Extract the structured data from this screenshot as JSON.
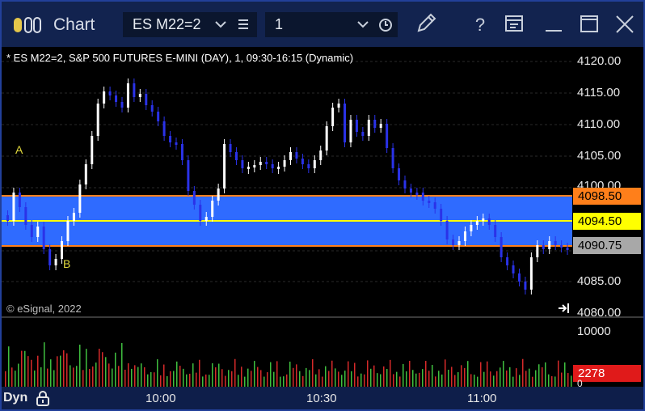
{
  "window": {
    "title": "Chart",
    "symbol": "ES M22=2",
    "interval": "1",
    "icons": [
      "pencil-icon",
      "help-icon",
      "window-layout-icon",
      "minimize-icon",
      "maximize-icon",
      "close-icon"
    ]
  },
  "chart": {
    "study_title": "* ES M22=2, S&P 500 FUTURES E-MINI (DAY), 1, 09:30-16:15 (Dynamic)",
    "copyright": "© eSignal, 2022",
    "point_a": "A",
    "point_b": "B",
    "price_ticks": [
      "4120.00",
      "4115.00",
      "4110.00",
      "4105.00",
      "4100.00",
      "4085.00",
      "4080.00"
    ],
    "price_tags": {
      "upper": "4098.50",
      "mid": "4094.50",
      "lower": "4090.75"
    },
    "volume_ticks": {
      "top": "10000",
      "last": "2278",
      "zero": "0"
    },
    "time_labels": [
      "10:00",
      "10:30",
      "11:00"
    ],
    "mode_label": "Dyn",
    "colors": {
      "band": "#2f6bff",
      "upper_line": "#ff7f1a",
      "mid_line": "#ffff00",
      "lower_line": "#ff7f1a",
      "up_candle": "#ffffff",
      "down_candle": "#2a32e8",
      "volume_up": "#3fbf3f",
      "volume_down": "#d62a2a"
    }
  }
}
